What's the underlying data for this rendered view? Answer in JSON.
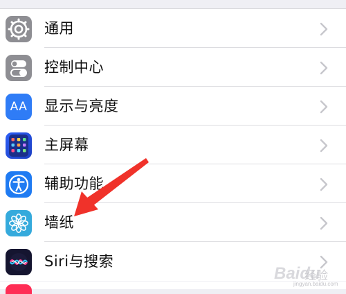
{
  "settings": {
    "items": [
      {
        "label": "通用",
        "icon": "gear-icon"
      },
      {
        "label": "控制中心",
        "icon": "toggle-switches-icon"
      },
      {
        "label": "显示与亮度",
        "icon": "text-size-aa-icon",
        "icon_text": "AA"
      },
      {
        "label": "主屏幕",
        "icon": "home-screen-grid-icon"
      },
      {
        "label": "辅助功能",
        "icon": "accessibility-person-icon"
      },
      {
        "label": "墙纸",
        "icon": "flower-icon"
      },
      {
        "label": "Siri与搜索",
        "icon": "siri-icon"
      }
    ]
  },
  "colors": {
    "background": "#efeff4",
    "arrow": "#f0322a",
    "chevron": "#c7c7cc"
  },
  "watermark": {
    "brand": "Baidu",
    "sub": "经验",
    "url": "jingyan.baidu.com"
  }
}
